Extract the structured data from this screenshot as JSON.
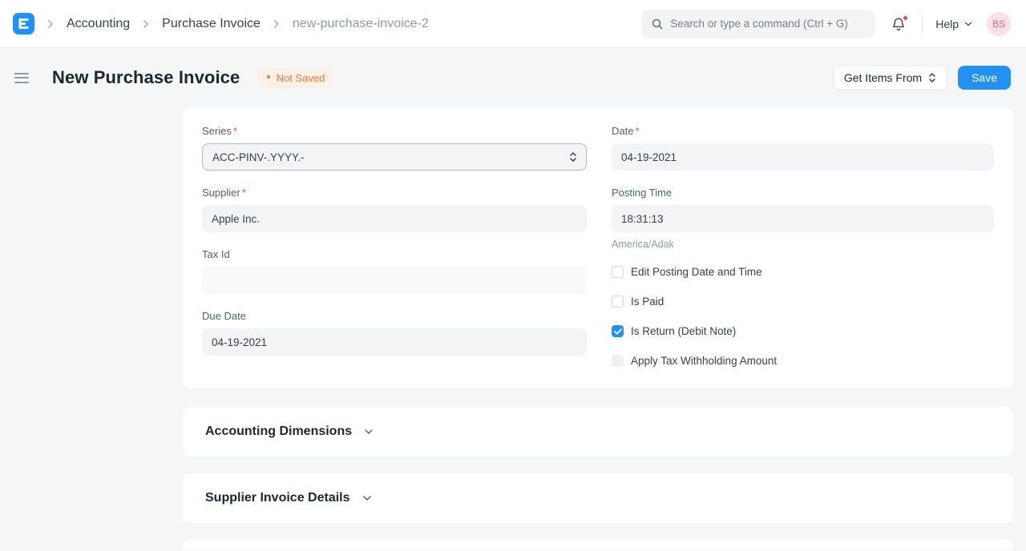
{
  "nav": {
    "breadcrumbs": [
      {
        "label": "Accounting"
      },
      {
        "label": "Purchase Invoice"
      },
      {
        "label": "new-purchase-invoice-2"
      }
    ],
    "search_placeholder": "Search or type a command (Ctrl + G)",
    "help_label": "Help",
    "avatar_initials": "BS"
  },
  "header": {
    "title": "New Purchase Invoice",
    "status_dot": "•",
    "status_badge": "Not Saved",
    "get_items_from_label": "Get Items From",
    "save_label": "Save"
  },
  "form": {
    "series": {
      "label": "Series",
      "required": "*",
      "value": "ACC-PINV-.YYYY.-"
    },
    "date": {
      "label": "Date",
      "required": "*",
      "value": "04-19-2021"
    },
    "supplier": {
      "label": "Supplier",
      "required": "*",
      "value": "Apple Inc."
    },
    "posting_time": {
      "label": "Posting Time",
      "value": "18:31:13",
      "timezone": "America/Adak"
    },
    "tax_id": {
      "label": "Tax Id",
      "value": ""
    },
    "due_date": {
      "label": "Due Date",
      "value": "04-19-2021"
    },
    "checkboxes": [
      {
        "label": "Edit Posting Date and Time",
        "checked": false,
        "disabled": false
      },
      {
        "label": "Is Paid",
        "checked": false,
        "disabled": false
      },
      {
        "label": "Is Return (Debit Note)",
        "checked": true,
        "disabled": false
      },
      {
        "label": "Apply Tax Withholding Amount",
        "checked": false,
        "disabled": true
      }
    ]
  },
  "sections": [
    {
      "title": "Accounting Dimensions"
    },
    {
      "title": "Supplier Invoice Details"
    }
  ],
  "colors": {
    "accent_blue": "#2490ef",
    "status_orange": "#f0773d",
    "status_bg": "#fdf0e7",
    "avatar_bg": "#fcdfe8",
    "avatar_text": "#e8628c",
    "notification_dot": "#e24c4c"
  }
}
